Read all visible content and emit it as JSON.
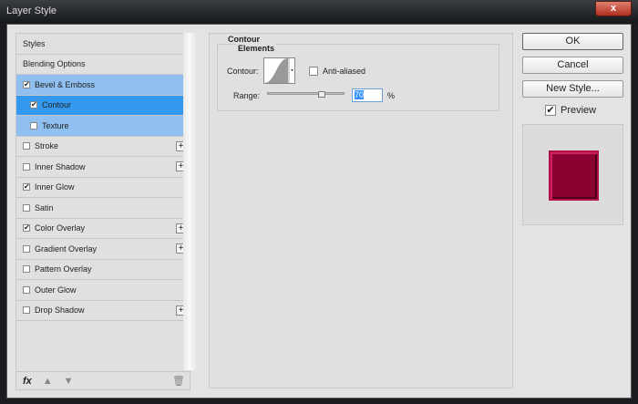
{
  "window": {
    "title": "Layer Style",
    "close": "x"
  },
  "styles_list": [
    {
      "label": "Styles",
      "checkbox": null,
      "plus": false
    },
    {
      "label": "Blending Options",
      "checkbox": null,
      "plus": false
    },
    {
      "label": "Bevel & Emboss",
      "checkbox": true,
      "plus": false
    },
    {
      "label": "Contour",
      "checkbox": true,
      "plus": false,
      "sub": true,
      "selected": true
    },
    {
      "label": "Texture",
      "checkbox": false,
      "plus": false,
      "sub": true
    },
    {
      "label": "Stroke",
      "checkbox": false,
      "plus": true
    },
    {
      "label": "Inner Shadow",
      "checkbox": false,
      "plus": true
    },
    {
      "label": "Inner Glow",
      "checkbox": true,
      "plus": false
    },
    {
      "label": "Satin",
      "checkbox": false,
      "plus": false
    },
    {
      "label": "Color Overlay",
      "checkbox": true,
      "plus": true
    },
    {
      "label": "Gradient Overlay",
      "checkbox": false,
      "plus": true
    },
    {
      "label": "Pattern Overlay",
      "checkbox": false,
      "plus": false
    },
    {
      "label": "Outer Glow",
      "checkbox": false,
      "plus": false
    },
    {
      "label": "Drop Shadow",
      "checkbox": false,
      "plus": true
    }
  ],
  "toolbar": {
    "fx": "fx"
  },
  "panel": {
    "section": "Contour",
    "group": "Elements",
    "contour_label": "Contour:",
    "anti_aliased": "Anti-aliased",
    "range_label": "Range:",
    "range_value": "70",
    "percent": "%"
  },
  "buttons": {
    "ok": "OK",
    "cancel": "Cancel",
    "new_style": "New Style...",
    "preview": "Preview"
  },
  "colors": {
    "preview_swatch": "#8a0030",
    "selected": "#3399f0",
    "highlight": "#8fc0f0"
  }
}
